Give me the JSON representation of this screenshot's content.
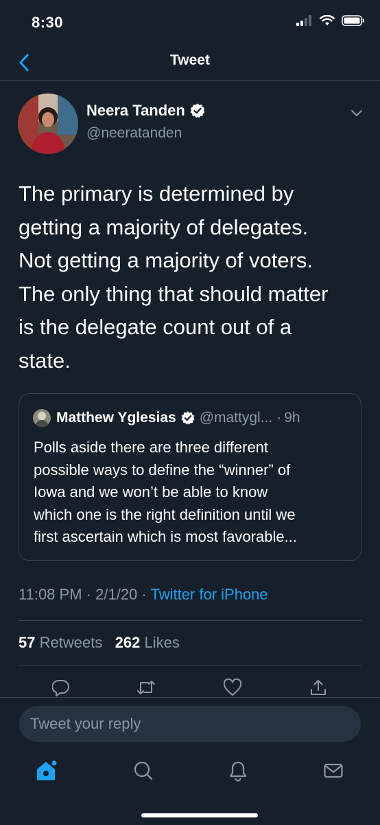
{
  "status_bar": {
    "time": "8:30"
  },
  "nav": {
    "title": "Tweet"
  },
  "author": {
    "name": "Neera Tanden",
    "handle": "@neeratanden"
  },
  "tweet": {
    "text": "The primary is determined by\ngetting a majority of delegates.\nNot getting a majority of voters.\nThe only thing that should matter\nis the delegate count out of a\nstate."
  },
  "quote": {
    "name": "Matthew Yglesias",
    "handle": "@mattygl...",
    "time": "9h",
    "text": "Polls aside there are three different\npossible ways to define the “winner” of\nIowa and we won’t be able to know\nwhich one is the right definition until we\nfirst ascertain which is most favorable..."
  },
  "meta": {
    "time": "11:08 PM",
    "date": "2/1/20",
    "separator": "·",
    "source": "Twitter for iPhone"
  },
  "stats": {
    "retweets_count": "57",
    "retweets_label": "Retweets",
    "likes_count": "262",
    "likes_label": "Likes"
  },
  "reply": {
    "placeholder": "Tweet your reply"
  },
  "colors": {
    "background": "#15202b",
    "accent": "#1da1f2",
    "secondary_text": "#8899a6",
    "border": "#38444d"
  },
  "icons": {
    "actions": [
      "reply-icon",
      "retweet-icon",
      "like-icon",
      "share-icon"
    ],
    "tabs": [
      "home-icon",
      "search-icon",
      "notifications-icon",
      "messages-icon"
    ]
  }
}
